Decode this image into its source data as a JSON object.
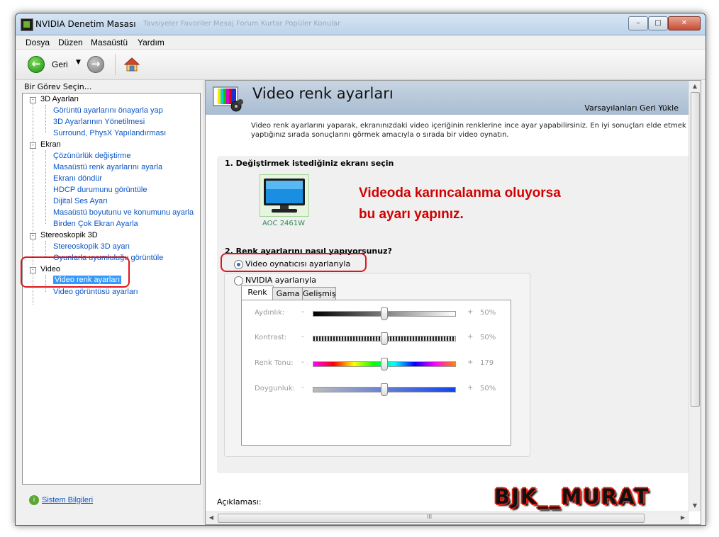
{
  "window": {
    "title": "NVIDIA Denetim Masası",
    "background_tabs": "Tavsiyeler   Favoriler   Mesaj   Forum   Kurtar   Popüler Konular",
    "minimize_label": "–",
    "maximize_label": "□",
    "close_label": "✕"
  },
  "menu": {
    "items": [
      "Dosya",
      "Düzen",
      "Masaüstü",
      "Yardım"
    ]
  },
  "toolbar": {
    "back_label": "Geri",
    "back_icon": "back-arrow-icon",
    "forward_icon": "forward-arrow-icon",
    "home_icon": "home-icon"
  },
  "left": {
    "header": "Bir Görev Seçin...",
    "tree": {
      "cat_3d": "3D Ayarları",
      "leaf_3d_1": "Görüntü ayarlarını önayarla yap",
      "leaf_3d_2": "3D Ayarlarının Yönetilmesi",
      "leaf_3d_3": "Surround, PhysX Yapılandırması",
      "cat_ekran": "Ekran",
      "leaf_e_1": "Çözünürlük değiştirme",
      "leaf_e_2": "Masaüstü renk ayarlarını ayarla",
      "leaf_e_3": "Ekranı döndür",
      "leaf_e_4": "HDCP durumunu görüntüle",
      "leaf_e_5": "Dijital Ses Ayarı",
      "leaf_e_6": "Masaüstü boyutunu ve konumunu ayarla",
      "leaf_e_7": "Birden Çok Ekran Ayarla",
      "cat_stereo": "Stereoskopik 3D",
      "leaf_s_1": "Stereoskopik 3D ayarı",
      "leaf_s_2": "Oyunlarla uyumluluğu görüntüle",
      "cat_video": "Video",
      "leaf_v_1": "Video renk ayarları",
      "leaf_v_2": "Video görüntüsü ayarları"
    },
    "system_info": "Sistem Bilgileri"
  },
  "main": {
    "title": "Video renk ayarları",
    "restore_defaults": "Varsayılanları Geri Yükle",
    "intro_line1": "Video renk ayarlarını yaparak, ekranınızdaki video içeriğinin renklerine ince ayar yapabilirsiniz. En iyi sonuçları elde etmek için, değiş",
    "intro_line2": "yaptığınız sırada sonuçlarını görmek amacıyla o sırada bir video oynatın.",
    "step1": "1. Değiştirmek istediğiniz ekranı seçin",
    "monitor_name": "AOC 2461W",
    "overlay_line1": "Videoda karıncalanma oluyorsa",
    "overlay_line2": "bu ayarı yapınız.",
    "step2": "2. Renk ayarlarını nasıl yapıyorsunuz?",
    "option1": "Video oynatıcısı ayarlarıyla",
    "option2": "NVIDIA ayarlarıyla",
    "option1_selected": true,
    "tabs": [
      "Renk",
      "Gama",
      "Gelişmiş"
    ],
    "active_tab": "Renk",
    "sliders": [
      {
        "label": "Aydınlık:",
        "minus": "-",
        "plus": "+",
        "value_text": "50%",
        "fraction": 0.5
      },
      {
        "label": "Kontrast:",
        "minus": "-",
        "plus": "+",
        "value_text": "50%",
        "fraction": 0.5
      },
      {
        "label": "Renk Tonu:",
        "minus": "-",
        "plus": "+",
        "value_text": "179",
        "fraction": 0.5
      },
      {
        "label": "Doygunluk:",
        "minus": "-",
        "plus": "+",
        "value_text": "50%",
        "fraction": 0.5
      }
    ],
    "description_label": "Açıklaması:",
    "scroll_grip": "III"
  },
  "watermark": "BJK__MURAT",
  "colors": {
    "highlight_red": "#e0141b",
    "link_blue": "#0a55c8",
    "nvidia_green": "#76b900"
  }
}
